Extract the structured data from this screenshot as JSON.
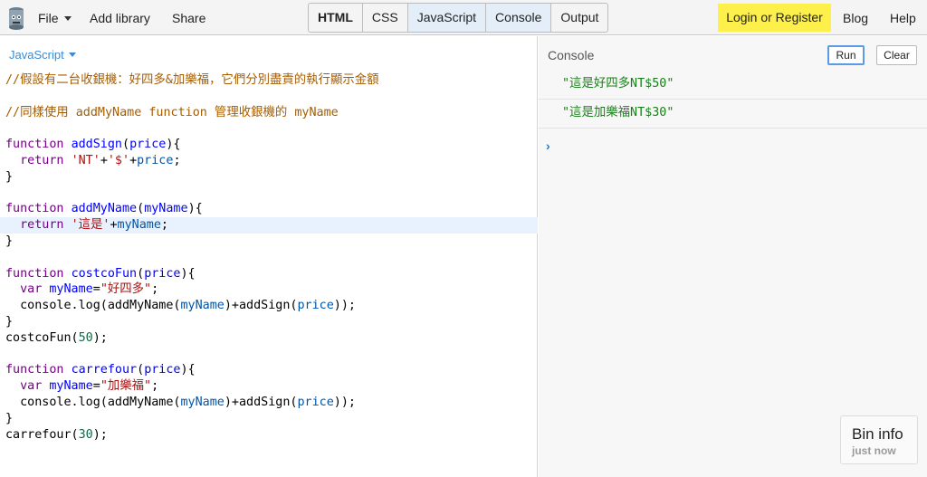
{
  "topbar": {
    "file": "File",
    "add_library": "Add library",
    "share": "Share",
    "panels": [
      {
        "label": "HTML",
        "bold": true,
        "active": false
      },
      {
        "label": "CSS",
        "bold": false,
        "active": false
      },
      {
        "label": "JavaScript",
        "bold": false,
        "active": true
      },
      {
        "label": "Console",
        "bold": false,
        "active": true
      },
      {
        "label": "Output",
        "bold": false,
        "active": false
      }
    ],
    "login": "Login or Register",
    "blog": "Blog",
    "help": "Help",
    "logo_icon": "jsbin-logo-icon"
  },
  "editor": {
    "language": "JavaScript",
    "highlighted_line": 10,
    "lines": [
      [
        [
          "cm-comment",
          "//假設有二台收銀機：好四多&加樂福，它們分別盡責的執行顯示金額"
        ]
      ],
      [],
      [
        [
          "cm-comment",
          "//同樣使用 addMyName function 管理收銀機的 myName"
        ]
      ],
      [],
      [
        [
          "cm-keyword",
          "function"
        ],
        [
          "cm-plain",
          " "
        ],
        [
          "cm-def",
          "addSign"
        ],
        [
          "cm-plain",
          "("
        ],
        [
          "cm-def",
          "price"
        ],
        [
          "cm-plain",
          "){"
        ]
      ],
      [
        [
          "cm-plain",
          "  "
        ],
        [
          "cm-keyword",
          "return"
        ],
        [
          "cm-plain",
          " "
        ],
        [
          "cm-str",
          "'NT'"
        ],
        [
          "cm-plain",
          "+"
        ],
        [
          "cm-str",
          "'$'"
        ],
        [
          "cm-plain",
          "+"
        ],
        [
          "cm-var",
          "price"
        ],
        [
          "cm-plain",
          ";"
        ]
      ],
      [
        [
          "cm-plain",
          "}"
        ]
      ],
      [],
      [
        [
          "cm-keyword",
          "function"
        ],
        [
          "cm-plain",
          " "
        ],
        [
          "cm-def",
          "addMyName"
        ],
        [
          "cm-plain",
          "("
        ],
        [
          "cm-def",
          "myName"
        ],
        [
          "cm-plain",
          "){"
        ]
      ],
      [
        [
          "cm-plain",
          "  "
        ],
        [
          "cm-keyword",
          "return"
        ],
        [
          "cm-plain",
          " "
        ],
        [
          "cm-str",
          "'這是'"
        ],
        [
          "cm-plain",
          "+"
        ],
        [
          "cm-var",
          "myName"
        ],
        [
          "cm-plain",
          ";"
        ]
      ],
      [
        [
          "cm-plain",
          "}"
        ]
      ],
      [],
      [
        [
          "cm-keyword",
          "function"
        ],
        [
          "cm-plain",
          " "
        ],
        [
          "cm-def",
          "costcoFun"
        ],
        [
          "cm-plain",
          "("
        ],
        [
          "cm-def",
          "price"
        ],
        [
          "cm-plain",
          "){"
        ]
      ],
      [
        [
          "cm-plain",
          "  "
        ],
        [
          "cm-keyword",
          "var"
        ],
        [
          "cm-plain",
          " "
        ],
        [
          "cm-def",
          "myName"
        ],
        [
          "cm-plain",
          "="
        ],
        [
          "cm-str",
          "\"好四多\""
        ],
        [
          "cm-plain",
          ";"
        ]
      ],
      [
        [
          "cm-plain",
          "  console.log(addMyName("
        ],
        [
          "cm-var",
          "myName"
        ],
        [
          "cm-plain",
          ")+addSign("
        ],
        [
          "cm-var",
          "price"
        ],
        [
          "cm-plain",
          "));"
        ]
      ],
      [
        [
          "cm-plain",
          "}"
        ]
      ],
      [
        [
          "cm-plain",
          "costcoFun("
        ],
        [
          "cm-num",
          "50"
        ],
        [
          "cm-plain",
          ");"
        ]
      ],
      [],
      [
        [
          "cm-keyword",
          "function"
        ],
        [
          "cm-plain",
          " "
        ],
        [
          "cm-def",
          "carrefour"
        ],
        [
          "cm-plain",
          "("
        ],
        [
          "cm-def",
          "price"
        ],
        [
          "cm-plain",
          "){"
        ]
      ],
      [
        [
          "cm-plain",
          "  "
        ],
        [
          "cm-keyword",
          "var"
        ],
        [
          "cm-plain",
          " "
        ],
        [
          "cm-def",
          "myName"
        ],
        [
          "cm-plain",
          "="
        ],
        [
          "cm-str",
          "\"加樂福\""
        ],
        [
          "cm-plain",
          ";"
        ]
      ],
      [
        [
          "cm-plain",
          "  console.log(addMyName("
        ],
        [
          "cm-var",
          "myName"
        ],
        [
          "cm-plain",
          ")+addSign("
        ],
        [
          "cm-var",
          "price"
        ],
        [
          "cm-plain",
          "));"
        ]
      ],
      [
        [
          "cm-plain",
          "}"
        ]
      ],
      [
        [
          "cm-plain",
          "carrefour("
        ],
        [
          "cm-num",
          "30"
        ],
        [
          "cm-plain",
          ");"
        ]
      ]
    ]
  },
  "console": {
    "title": "Console",
    "run": "Run",
    "clear": "Clear",
    "logs": [
      "\"這是好四多NT$50\"",
      "\"這是加樂福NT$30\""
    ],
    "prompt": "›"
  },
  "bin_info": {
    "title": "Bin info",
    "subtitle": "just now"
  }
}
